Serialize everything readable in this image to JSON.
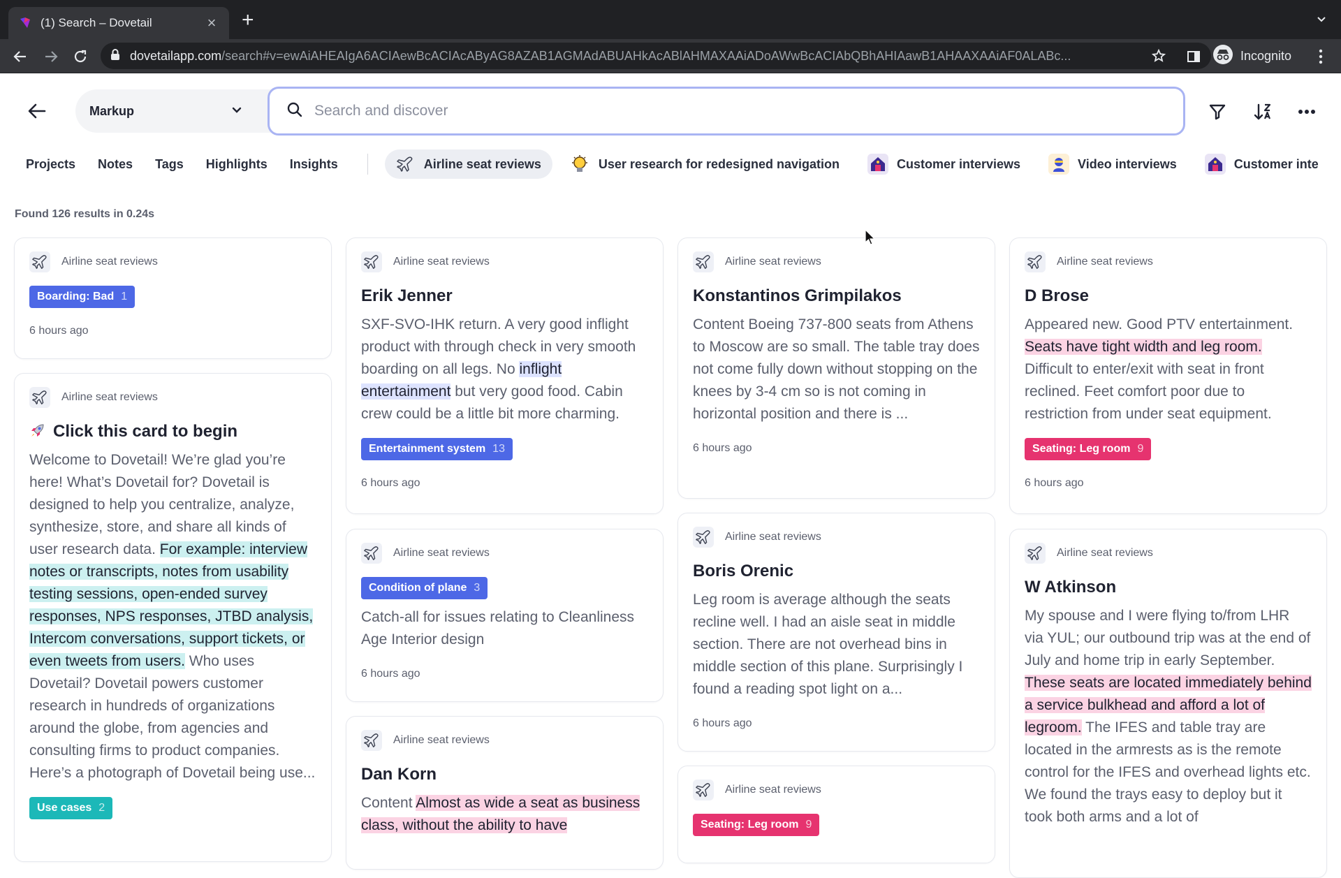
{
  "browser": {
    "tab_title": "(1) Search – Dovetail",
    "tab_close": "×",
    "new_tab": "+",
    "url_host": "dovetailapp.com",
    "url_path": "/search#v=ewAiAHEAIgA6ACIAewBcACIAcAByAG8AZAB1AGMAdABUAHkAcABlAHMAXAAiADoAWwBcACIAbQBhAHIAawB1AHAAXAAiAF0ALABc...",
    "incognito_label": "Incognito"
  },
  "header": {
    "workspace": "Markup",
    "search_placeholder": "Search and discover"
  },
  "filters": {
    "links": [
      "Projects",
      "Notes",
      "Tags",
      "Highlights",
      "Insights"
    ],
    "projects": [
      {
        "label": "Airline seat reviews",
        "icon": "airplane-icon"
      },
      {
        "label": "User research for redesigned navigation",
        "icon": "lightbulb-icon"
      },
      {
        "label": "Customer interviews",
        "icon": "house-icon"
      },
      {
        "label": "Video interviews",
        "icon": "person-icon"
      },
      {
        "label": "Customer inte",
        "icon": "house-icon"
      }
    ]
  },
  "results": {
    "count_text": "Found 126 results in 0.24s"
  },
  "cards": {
    "c1": {
      "project": "Airline seat reviews",
      "tag": "Boarding: Bad",
      "tag_count": "1",
      "time": "6 hours ago"
    },
    "c2": {
      "project": "Airline seat reviews",
      "title": "Click this card to begin",
      "body_1": "Welcome to Dovetail! We’re glad you’re here! What’s Dovetail for? Dovetail is designed to help you centralize, analyze, synthesize, store, and share all kinds of user research data. ",
      "body_hl": "For example: interview notes or transcripts, notes from usability testing sessions, open-ended survey responses, NPS responses, JTBD analysis, Intercom conversations, support tickets, or even tweets from users.",
      "body_2": " Who uses Dovetail? Dovetail powers customer research in hundreds of organizations around the globe, from agencies and consulting firms to product companies. Here’s a photograph of Dovetail being use...",
      "tag": "Use cases",
      "tag_count": "2"
    },
    "c3": {
      "project": "Airline seat reviews",
      "title": "Erik Jenner",
      "body_1": "SXF-SVO-IHK return. A very good inflight product with through check in very smooth boarding on all legs. No ",
      "body_hl": "inflight entertainment",
      "body_2": " but very good food. Cabin crew could be a little bit more charming.",
      "tag": "Entertainment system",
      "tag_count": "13",
      "time": "6 hours ago"
    },
    "c4": {
      "project": "Airline seat reviews",
      "tag": "Condition of plane",
      "tag_count": "3",
      "body": "Catch-all for issues relating to Cleanliness Age Interior design",
      "time": "6 hours ago"
    },
    "c5": {
      "project": "Airline seat reviews",
      "title": "Dan Korn",
      "body_1": "Content ",
      "body_hl": "Almost as wide a seat as business class, without the ability to have"
    },
    "c6": {
      "project": "Airline seat reviews",
      "title": "Konstantinos Grimpilakos",
      "body": "Content Boeing 737-800 seats from Athens to Moscow are so small. The table tray does not come fully down without stopping on the knees by 3-4 cm so is not coming in horizontal position and there is ...",
      "time": "6 hours ago"
    },
    "c7": {
      "project": "Airline seat reviews",
      "title": "Boris Orenic",
      "body": "Leg room is average although the seats recline well. I had an aisle seat in middle section. There are not overhead bins in middle section of this plane. Surprisingly I found a reading spot light on a...",
      "time": "6 hours ago"
    },
    "c8": {
      "project": "Airline seat reviews",
      "tag": "Seating: Leg room",
      "tag_count": "9"
    },
    "c9": {
      "project": "Airline seat reviews",
      "title": "D Brose",
      "body_1": "Appeared new. Good PTV entertainment. ",
      "body_hl": "Seats have tight width and leg room.",
      "body_2": " Difficult to enter/exit with seat in front reclined. Feet comfort poor due to restriction from under seat equipment.",
      "tag": "Seating: Leg room",
      "tag_count": "9",
      "time": "6 hours ago"
    },
    "c10": {
      "project": "Airline seat reviews",
      "title": "W Atkinson",
      "body_1": "My spouse and I were flying to/from LHR via YUL; our outbound trip was at the end of July and home trip in early September. ",
      "body_hl": "These seats are located immediately behind a service bulkhead and afford a lot of legroom.",
      "body_2": " The IFES and table tray are located in the armrests as is the remote control for the IFES and overhead lights etc. We found the trays easy to deploy but it took both arms and a lot of"
    }
  },
  "colors": {
    "tag_blue": "#4d68e6",
    "tag_pink": "#e6336f",
    "tag_teal": "#1cb8b8",
    "highlight_blue": "#dde3ff",
    "highlight_pink": "#fbd3e3",
    "highlight_teal": "#ccf0f0",
    "search_focus_border": "#a9b4f3"
  }
}
